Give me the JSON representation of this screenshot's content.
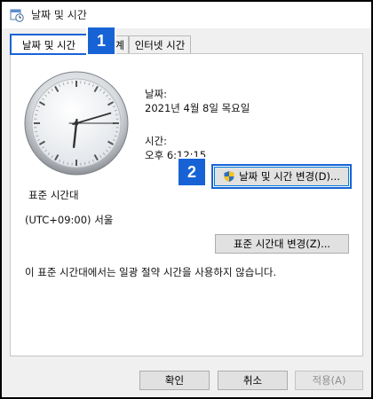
{
  "window": {
    "title": "날짜 및 시간"
  },
  "tabs": [
    {
      "label": "날짜 및 시간",
      "active": true
    },
    {
      "label": "계"
    },
    {
      "label": "인터넷 시간"
    }
  ],
  "date": {
    "label": "날짜:",
    "value": "2021년 4월 8일 목요일"
  },
  "time": {
    "label": "시간:",
    "value": "오후 6:12:15"
  },
  "buttons": {
    "change_datetime": "날짜 및 시간 변경(D)...",
    "change_timezone": "표준 시간대 변경(Z)...",
    "ok": "확인",
    "cancel": "취소",
    "apply": "적용(A)"
  },
  "timezone": {
    "heading": "표준 시간대",
    "value": "(UTC+09:00) 서울",
    "dst_note": "이 표준 시간대에서는 일광 절약 시간을 사용하지 않습니다."
  },
  "annotations": {
    "badge1": "1",
    "badge2": "2"
  },
  "clock": {
    "hour": 6,
    "minute": 12,
    "second": 15
  },
  "colors": {
    "accent": "#1763d6",
    "panel": "#ffffff",
    "window": "#f0f0f0"
  },
  "icons": {
    "title": "datetime-app-icon",
    "uac": "uac-shield-icon"
  }
}
